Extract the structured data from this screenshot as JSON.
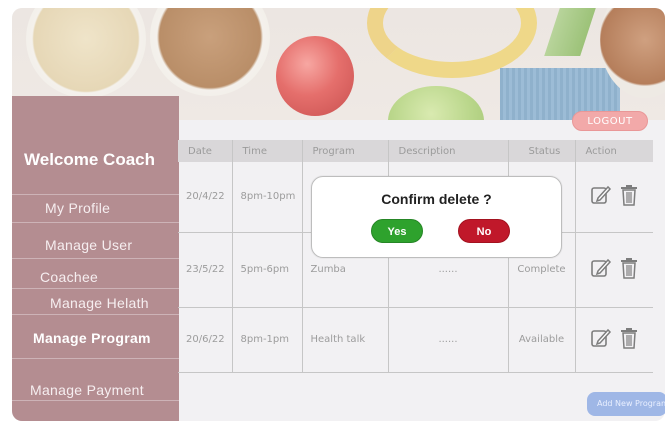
{
  "header": {
    "logout_label": "LOGOUT"
  },
  "sidebar": {
    "welcome": "Welcome Coach",
    "items": [
      {
        "label": "My Profile"
      },
      {
        "label": "Manage User"
      },
      {
        "label": "Coachee"
      },
      {
        "label": "Manage Helath"
      },
      {
        "label": "Manage Program"
      },
      {
        "label": "Manage Payment"
      }
    ]
  },
  "table": {
    "columns": [
      "Date",
      "Time",
      "Program",
      "Description",
      "Status",
      "Action"
    ],
    "rows": [
      {
        "date": "20/4/22",
        "time": "8pm-10pm",
        "program": "",
        "description": "",
        "status": "te"
      },
      {
        "date": "23/5/22",
        "time": "5pm-6pm",
        "program": "Zumba",
        "description": "......",
        "status": "Complete"
      },
      {
        "date": "20/6/22",
        "time": "8pm-1pm",
        "program": "Health talk",
        "description": "......",
        "status": "Available"
      }
    ]
  },
  "add_button_label": "Add New Program",
  "modal": {
    "title": "Confirm delete ?",
    "yes_label": "Yes",
    "no_label": "No"
  },
  "colors": {
    "sidebar": "#b48d91",
    "logout": "#f2a9a9",
    "yes": "#2ea22d",
    "no": "#c0182a",
    "add_button": "#9fb7e6"
  },
  "icons": {
    "edit": "edit-icon",
    "delete": "trash-icon"
  }
}
